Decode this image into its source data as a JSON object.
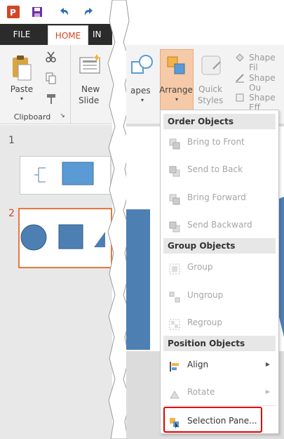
{
  "tabs": {
    "file": "FILE",
    "home": "HOME",
    "insert_partial": "IN"
  },
  "ribbon": {
    "paste": "Paste",
    "new_slide_line1": "New",
    "new_slide_line2": "Slide",
    "clipboard_group": "Clipboard",
    "shapes_partial": "apes",
    "arrange": "Arrange",
    "quick_styles_line1": "Quick",
    "quick_styles_line2": "Styles",
    "shape_fill": "Shape Fil",
    "shape_outline": "Shape Ou",
    "shape_effects": "Shape Eff"
  },
  "slides": [
    {
      "number": "1"
    },
    {
      "number": "2"
    }
  ],
  "arrange_menu": {
    "order_header": "Order Objects",
    "order_items": [
      {
        "label": "Bring to Front",
        "enabled": false
      },
      {
        "label": "Send to Back",
        "enabled": false
      },
      {
        "label": "Bring Forward",
        "enabled": false
      },
      {
        "label": "Send Backward",
        "enabled": false
      }
    ],
    "group_header": "Group Objects",
    "group_items": [
      {
        "label": "Group",
        "enabled": false
      },
      {
        "label": "Ungroup",
        "enabled": false
      },
      {
        "label": "Regroup",
        "enabled": false
      }
    ],
    "position_header": "Position Objects",
    "position_items": [
      {
        "label": "Align",
        "enabled": true,
        "submenu": true
      },
      {
        "label": "Rotate",
        "enabled": false,
        "submenu": true
      }
    ],
    "selection_pane": "Selection Pane..."
  },
  "colors": {
    "accent_orange": "#d24726",
    "shape_blue": "#4d7fb3",
    "highlight_red": "#e00000"
  }
}
